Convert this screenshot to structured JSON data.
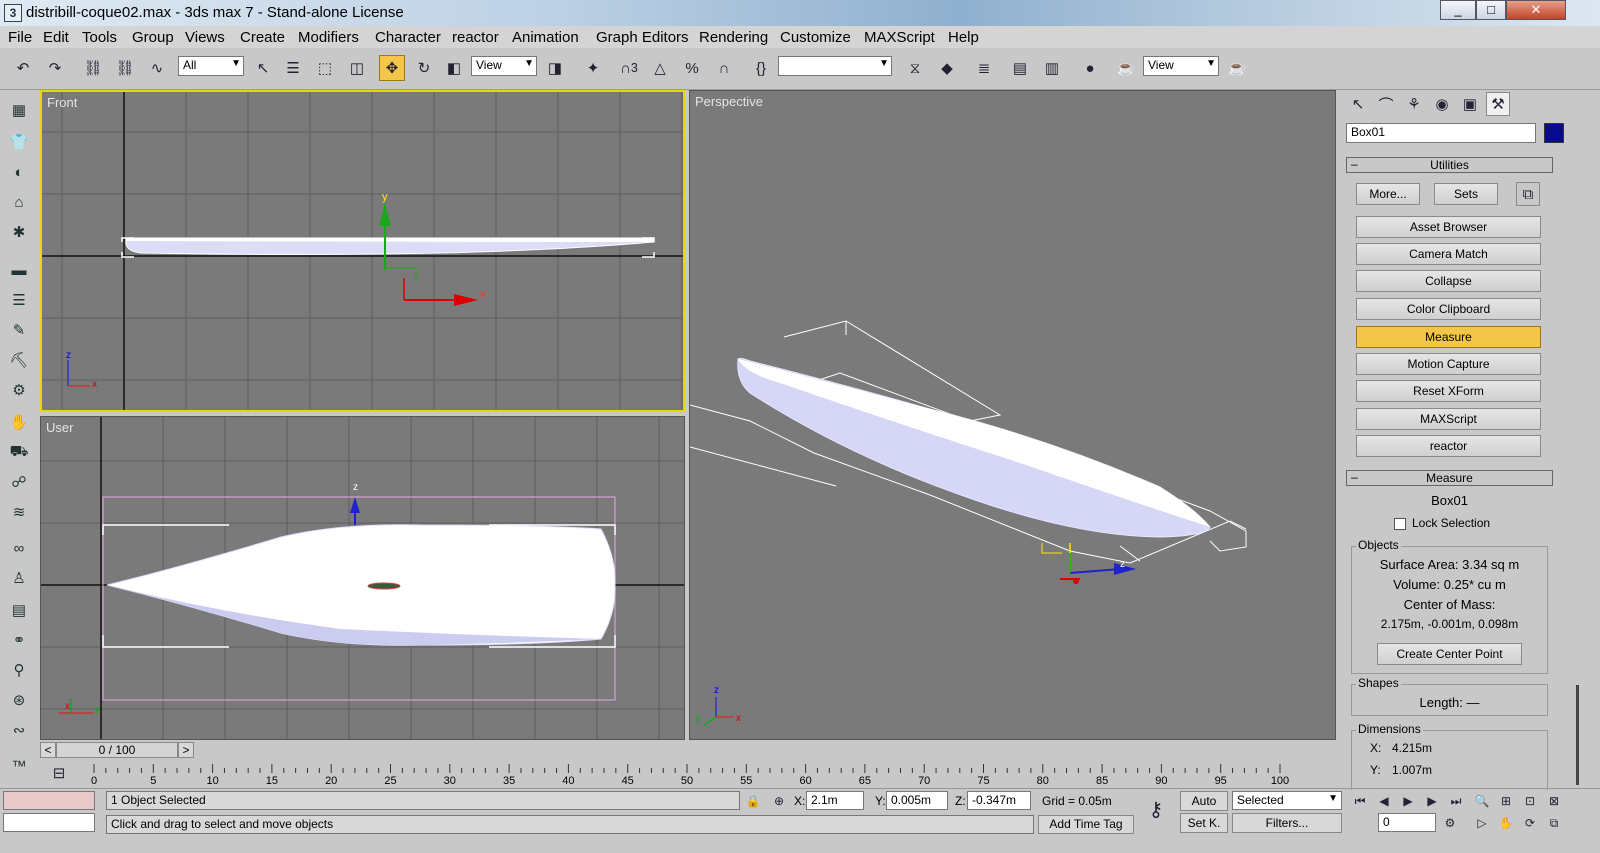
{
  "window": {
    "title": "distribill-coque02.max - 3ds max 7  - Stand-alone License",
    "app_icon": "3ds-max-logo",
    "min": "_",
    "max": "□",
    "close": "✕"
  },
  "menu": [
    "File",
    "Edit",
    "Tools",
    "Group",
    "Views",
    "Create",
    "Modifiers",
    "Character",
    "reactor",
    "Animation",
    "Graph Editors",
    "Rendering",
    "Customize",
    "MAXScript",
    "Help"
  ],
  "toolbar": {
    "selection_filter": "All",
    "ref_coord": "View",
    "named_selection": "",
    "render_view": "View",
    "snap_angle_label": "3"
  },
  "viewports": {
    "front": {
      "label": "Front",
      "axis_x": "x",
      "axis_y": "y",
      "mini_x": "x",
      "mini_z": "z"
    },
    "user": {
      "label": "User",
      "axis_z": "z",
      "mini_x": "x",
      "mini_y": "y"
    },
    "perspective": {
      "label": "Perspective",
      "axis_z": "z",
      "mini_x": "x",
      "mini_y": "y",
      "mini_z": "z"
    }
  },
  "timeline": {
    "frame_display": "0 / 100",
    "prev": "<",
    "next": ">",
    "ticks": [
      0,
      5,
      10,
      15,
      20,
      25,
      30,
      35,
      40,
      45,
      50,
      55,
      60,
      65,
      70,
      75,
      80,
      85,
      90,
      95,
      100
    ]
  },
  "status": {
    "selection": "1 Object Selected",
    "prompt": "Click and drag to select and move objects",
    "x_label": "X:",
    "x": "2.1m",
    "y_label": "Y:",
    "y": "0.005m",
    "z_label": "Z:",
    "z": "-0.347m",
    "grid": "Grid = 0.05m",
    "add_time_tag": "Add Time Tag",
    "auto_key": "Auto",
    "set_key": "Set K.",
    "key_mode": "Selected",
    "filters": "Filters...",
    "current_frame": "0"
  },
  "command_panel": {
    "object_name": "Box01",
    "object_color": "#0a0a8c",
    "utilities_title": "Utilities",
    "more": "More...",
    "sets": "Sets",
    "buttons": [
      "Asset Browser",
      "Camera Match",
      "Collapse",
      "Color Clipboard",
      "Measure",
      "Motion Capture",
      "Reset XForm",
      "MAXScript",
      "reactor"
    ],
    "active_button": "Measure",
    "measure_title": "Measure",
    "measured_object": "Box01",
    "lock_selection": "Lock Selection",
    "objects_group": "Objects",
    "surface_area": "Surface Area:  3.34 sq m",
    "volume": "Volume:  0.25* cu m",
    "center_of_mass_label": "Center of Mass:",
    "center_of_mass": "2.175m, -0.001m, 0.098m",
    "create_center_point": "Create Center Point",
    "shapes_group": "Shapes",
    "length": "Length:  —",
    "dimensions_group": "Dimensions",
    "dim_x_label": "X:",
    "dim_x": "4.215m",
    "dim_y_label": "Y:",
    "dim_y": "1.007m"
  },
  "colors": {
    "active_viewport_border": "#e8d800",
    "active_button": "#f3c64a",
    "viewport_bg": "#7a7a7a",
    "hull": "#eeeeff"
  }
}
